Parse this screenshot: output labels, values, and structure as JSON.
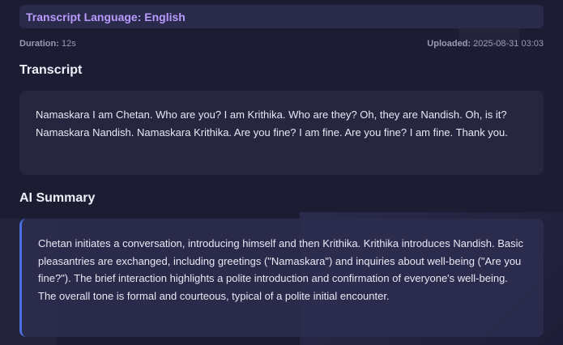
{
  "header": {
    "language_label": "Transcript Language: English"
  },
  "meta": {
    "duration_label": "Duration:",
    "duration_value": "12s",
    "uploaded_label": "Uploaded:",
    "uploaded_value": "2025-08-31 03:03"
  },
  "transcript": {
    "title": "Transcript",
    "text": "Namaskara I am Chetan. Who are you? I am Krithika. Who are they? Oh, they are Nandish. Oh, is it? Namaskara Nandish. Namaskara Krithika. Are you fine? I am fine. Are you fine? I am fine. Thank you."
  },
  "summary": {
    "title": "AI Summary",
    "text": "Chetan initiates a conversation, introducing himself and then Krithika. Krithika introduces Nandish. Basic pleasantries are exchanged, including greetings (\"Namaskara\") and inquiries about well-being (\"Are you fine?\"). The brief interaction highlights a polite introduction and confirmation of everyone's well-being. The overall tone is formal and courteous, typical of a polite initial encounter."
  },
  "colors": {
    "background": "#1c1c33",
    "accent_purple": "#b99bff",
    "accent_blue": "#4b6fe0"
  }
}
